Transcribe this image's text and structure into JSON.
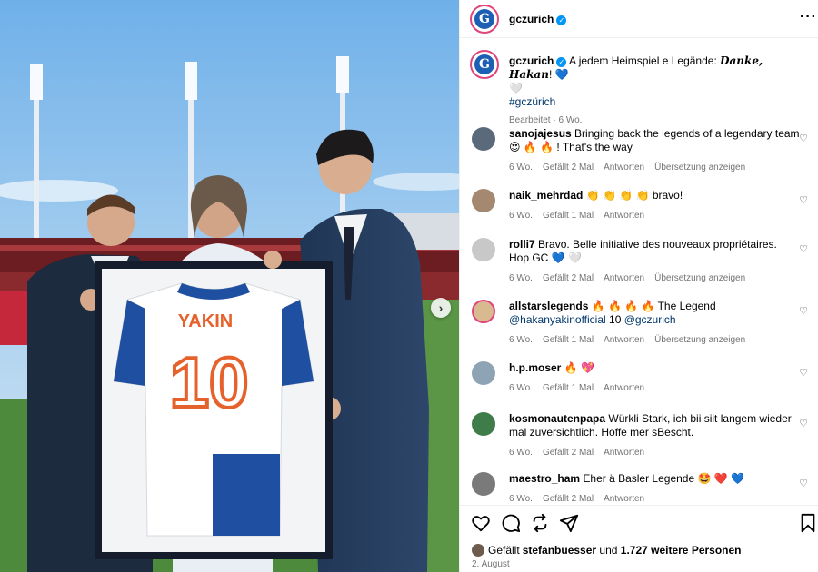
{
  "post": {
    "username": "gczurich",
    "avatar_text": "G",
    "jersey_name": "YAKIN",
    "jersey_number": "10"
  },
  "caption": {
    "username": "gczurich",
    "text_pre": "A jedem Heimspiel e Legände: ",
    "text_bold": "Danke, Hakan",
    "text_post": "! 💙",
    "text_line2": "🤍",
    "hashtag": "#gczürich",
    "meta": "Bearbeitet · 6 Wo."
  },
  "comments": [
    {
      "username": "sanojajesus",
      "text": "Bringing back the legends of a legendary team 😍 🔥 🔥 ! That's the way",
      "time": "6 Wo.",
      "likes": "Gefällt 2 Mal",
      "reply": "Antworten",
      "translate": "Übersetzung anzeigen",
      "avatar_color": "#5b6a7a"
    },
    {
      "username": "naik_mehrdad",
      "text": "👏 👏 👏 👏 bravo!",
      "time": "6 Wo.",
      "likes": "Gefällt 1 Mal",
      "reply": "Antworten",
      "translate": "",
      "avatar_color": "#a58870"
    },
    {
      "username": "rolli7",
      "text": "Bravo. Belle initiative des nouveaux propriétaires. Hop GC 💙 🤍",
      "time": "6 Wo.",
      "likes": "Gefällt 2 Mal",
      "reply": "Antworten",
      "translate": "Übersetzung anzeigen",
      "avatar_color": "#c8c8c8"
    },
    {
      "username": "allstarslegends",
      "text_pre": "🔥 🔥 🔥 🔥 The Legend ",
      "mention1": "@hakanyakinofficial",
      "text_mid": " 10 ",
      "mention2": "@gczurich",
      "time": "6 Wo.",
      "likes": "Gefällt 1 Mal",
      "reply": "Antworten",
      "translate": "Übersetzung anzeigen",
      "avatar_color": "#d9b98f"
    },
    {
      "username": "h.p.moser",
      "text": "🔥 💖",
      "time": "6 Wo.",
      "likes": "Gefällt 1 Mal",
      "reply": "Antworten",
      "translate": "",
      "avatar_color": "#8ea3b3"
    },
    {
      "username": "kosmonautenpapa",
      "text": "Würkli Stark, ich bii siit langem wieder mal zuversichtlich. Hoffe mer sBescht.",
      "time": "6 Wo.",
      "likes": "Gefällt 2 Mal",
      "reply": "Antworten",
      "translate": "",
      "avatar_color": "#3e7d4a"
    },
    {
      "username": "maestro_ham",
      "text": "Eher ä Basler Legende 🤩 ❤️ 💙",
      "time": "6 Wo.",
      "likes": "Gefällt 2 Mal",
      "reply": "Antworten",
      "translate": "",
      "avatar_color": "#7a7a7a"
    }
  ],
  "footer": {
    "likes_prefix": "Gefällt ",
    "likes_user": "stefanbuesser",
    "likes_mid": " und ",
    "likes_count": "1.727 weitere Personen",
    "date": "2. August"
  },
  "icons": [
    "heart-icon",
    "comment-icon",
    "share-icon",
    "send-icon",
    "bookmark-icon",
    "more-icon",
    "verified-icon",
    "chevron-right-icon"
  ]
}
